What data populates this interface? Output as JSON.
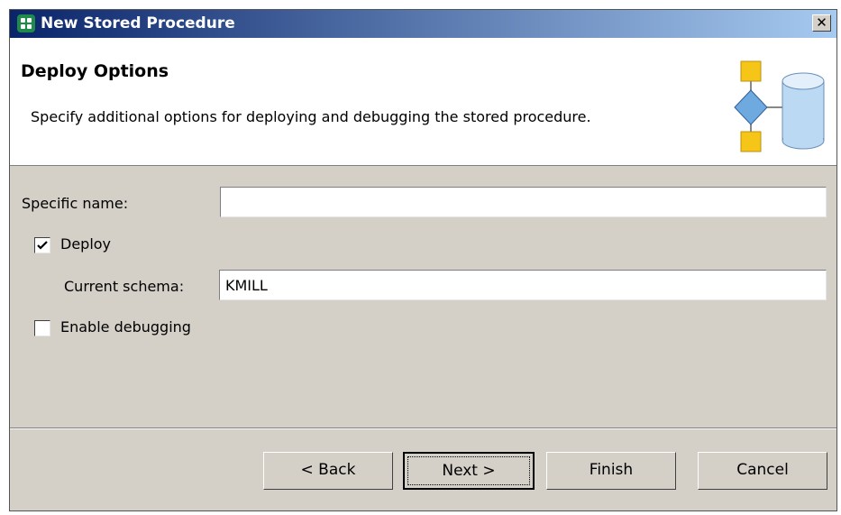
{
  "window": {
    "title": "New Stored Procedure",
    "close_glyph": "✕"
  },
  "banner": {
    "title": "Deploy Options",
    "description": "Specify additional options for deploying and debugging the stored procedure.",
    "graphic": "database-flow-icon"
  },
  "form": {
    "specific_name": {
      "label": "Specific name:",
      "value": ""
    },
    "deploy": {
      "label": "Deploy",
      "checked": true
    },
    "current_schema": {
      "label": "Current schema:",
      "value": "KMILL"
    },
    "enable_debugging": {
      "label": "Enable debugging",
      "checked": false
    }
  },
  "buttons": {
    "back": "< Back",
    "next": "Next >",
    "finish": "Finish",
    "cancel": "Cancel"
  },
  "colors": {
    "title_gradient_start": "#0a246a",
    "title_gradient_end": "#a6caf0",
    "dialog_bg": "#d4d0c8",
    "graphic_yellow": "#f5c518",
    "graphic_blue": "#bcd9f4"
  }
}
